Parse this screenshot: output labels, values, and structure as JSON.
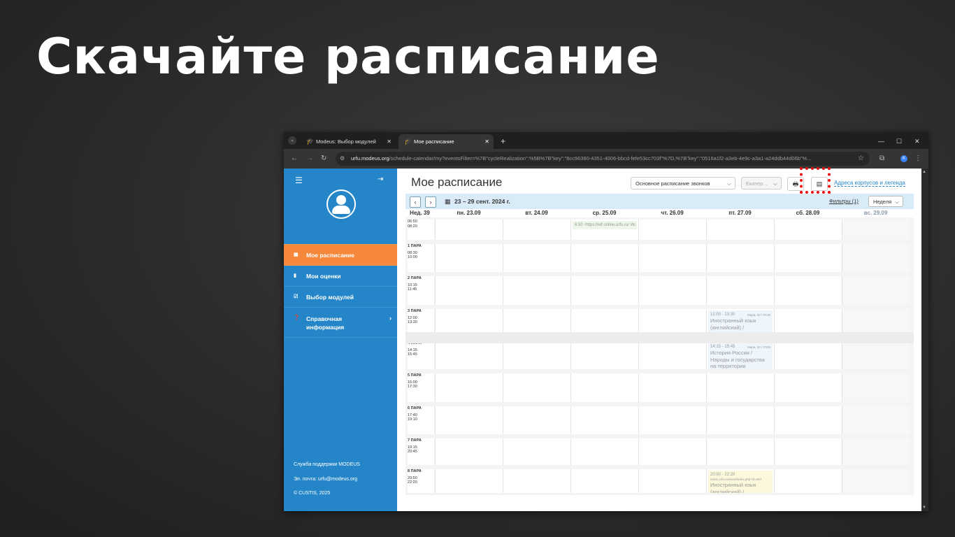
{
  "slide": {
    "title": "Скачайте расписание"
  },
  "browser": {
    "tabs": [
      {
        "label": "Modeus: Выбор модулей",
        "active": false
      },
      {
        "label": "Мое расписание",
        "active": true
      }
    ],
    "url_host": "urfu.modeus.org",
    "url_rest": "/schedule-calendar/my?eventsFilter=%7B\"cycleRealization\":%5B%7B\"key\":\"8cc96380-4351-4006-bbcd-fefe53cc703f\"%7D,%7B\"key\":\"0516a1f2-a3eb-4e9c-a3a1-a24ddb44d06b\"%...",
    "profile_letter": "K"
  },
  "sidebar": {
    "items": [
      {
        "label": "Мое расписание",
        "icon": "calendar-icon",
        "active": true
      },
      {
        "label": "Мои оценки",
        "icon": "bookmark-icon",
        "active": false
      },
      {
        "label": "Выбор модулей",
        "icon": "checkbox-icon",
        "active": false
      },
      {
        "label": "Справочная информация",
        "icon": "question-circle-icon",
        "active": false
      }
    ],
    "footer": {
      "support": "Служба поддержки MODEUS",
      "email": "Эл. почта: urfu@modeus.org",
      "copyright": "© CUSTIS, 2025"
    }
  },
  "main": {
    "title": "Мое расписание",
    "bell_schedule": "Основное расписание звонков",
    "city": "Екатер...",
    "addresses_link": "Адреса корпусов и легенда",
    "week_range": "23 – 29 сент. 2024 г.",
    "filters": "Фильтры (1)",
    "view": "Неделя",
    "accent_color": "#2486c8",
    "highlight_color": "#ee1111"
  },
  "calendar": {
    "week_no": "Нед. 39",
    "days": [
      "пн. 23.09",
      "вт. 24.09",
      "ср. 25.09",
      "чт. 26.09",
      "пт. 27.09",
      "сб. 28.09",
      "вс. 29.09"
    ],
    "slots": [
      {
        "label": "",
        "start": "06:50",
        "end": "08:20"
      },
      {
        "label": "1 ПАРА",
        "start": "08:30",
        "end": "10:00"
      },
      {
        "label": "2 ПАРА",
        "start": "10:15",
        "end": "11:45"
      },
      {
        "label": "3 ПАРА",
        "start": "12:00",
        "end": "13:30"
      },
      {
        "label": "4 ПАРА",
        "start": "14:15",
        "end": "15:45"
      },
      {
        "label": "5 ПАРА",
        "start": "16:00",
        "end": "17:30"
      },
      {
        "label": "6 ПАРА",
        "start": "17:40",
        "end": "19:10"
      },
      {
        "label": "7 ПАРА",
        "start": "19:15",
        "end": "20:45"
      },
      {
        "label": "8 ПАРА",
        "start": "20:50",
        "end": "22:20"
      }
    ],
    "events": [
      {
        "slot": 0,
        "day": 2,
        "time": "6:50 -",
        "room": "",
        "title": "https://elf.online.urfu.ru/ Ис",
        "extra": "",
        "bg": "#eef6ea"
      },
      {
        "slot": 3,
        "day": 4,
        "time": "12:00 - 13:30",
        "room": "Мира, 32 / Р138",
        "title": "Иностранный язык (английский) / Практическое занятие",
        "extra": "",
        "bg": "#eef5fc"
      },
      {
        "slot": 4,
        "day": 4,
        "time": "14:15 - 15:45",
        "room": "Мира, 32 / Р233",
        "title": "История России / Народы и государства на территории",
        "extra": "",
        "bg": "#eef5fc"
      },
      {
        "slot": 8,
        "day": 4,
        "time": "20:50 - 22:20",
        "room": "",
        "title": "Иностранный язык (английский) /",
        "extra": "sam1.urfu.ru/enrol/index.php?id=657",
        "bg": "#fbf8dc"
      }
    ]
  }
}
